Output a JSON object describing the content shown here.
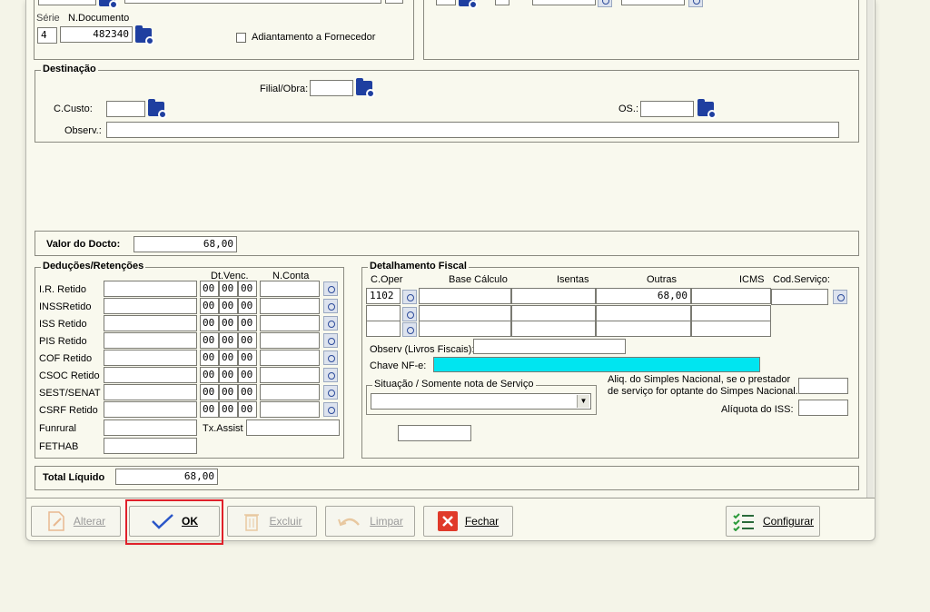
{
  "top": {
    "serie_label": "Série",
    "serie_value": "4",
    "ndoc_label": "N.Documento",
    "ndoc_value": "482340",
    "adiantamento_label": "Adiantamento a Fornecedor"
  },
  "destinacao": {
    "title": "Destinação",
    "filial_label": "Filial/Obra:",
    "filial_value": "",
    "ccusto_label": "C.Custo:",
    "ccusto_value": "",
    "os_label": "OS.:",
    "os_value": "",
    "observ_label": "Observ.:",
    "observ_value": ""
  },
  "valor": {
    "label": "Valor do Docto:",
    "value": "68,00"
  },
  "deducoes": {
    "title": "Deduções/Retenções",
    "dtvenc_label": "Dt.Venc.",
    "nconta_label": "N.Conta",
    "date_part": "00",
    "rows": [
      {
        "label": "I.R. Retido"
      },
      {
        "label": "INSSRetido"
      },
      {
        "label": "ISS Retido"
      },
      {
        "label": "PIS Retido"
      },
      {
        "label": "COF Retido"
      },
      {
        "label": "CSOC Retido"
      },
      {
        "label": "SEST/SENAT"
      },
      {
        "label": "CSRF Retido"
      }
    ],
    "funrural_label": "Funrural",
    "fethab_label": "FETHAB",
    "txassist_label": "Tx.Assist"
  },
  "fiscal": {
    "title": "Detalhamento Fiscal",
    "headers": {
      "coper": "C.Oper",
      "base": "Base Cálculo",
      "isentas": "Isentas",
      "outras": "Outras",
      "icms": "ICMS",
      "codserv": "Cod.Serviço:"
    },
    "row1_coper": "1102",
    "row1_outras": "68,00",
    "observ_label": "Observ (Livros Fiscais):",
    "chave_label": "Chave NF-e:",
    "chave_color": "#00e5f0",
    "situacao_label": "Situação / Somente nota de Serviço",
    "situacao_value": "",
    "simples_label_1": "Aliq. do Simples Nacional, se o prestador",
    "simples_label_2": "de serviço for optante do Simpes Nacional.",
    "aliq_iss_label": "Alíquota do ISS:"
  },
  "total": {
    "label": "Total Líquido",
    "value": "68,00"
  },
  "buttons": {
    "alterar": "Alterar",
    "ok": "OK",
    "excluir": "Excluir",
    "limpar": "Limpar",
    "fechar": "Fechar",
    "configurar": "Configurar"
  },
  "colors": {
    "highlight": "#e0202a",
    "lookup_icon": "#1f3fa0"
  }
}
